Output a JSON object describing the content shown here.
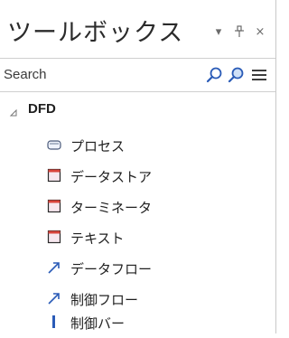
{
  "header": {
    "title": "ツールボックス"
  },
  "window_controls": {
    "dropdown_glyph": "▾",
    "pin_glyph": "ᵽ",
    "close_glyph": "×"
  },
  "search": {
    "placeholder": "Search"
  },
  "group": {
    "label": "DFD",
    "expanded": true
  },
  "items": [
    {
      "label": "プロセス",
      "icon": "process-shape-icon"
    },
    {
      "label": "データストア",
      "icon": "datastore-element-icon"
    },
    {
      "label": "ターミネータ",
      "icon": "terminator-element-icon"
    },
    {
      "label": "テキスト",
      "icon": "text-element-icon"
    },
    {
      "label": "データフロー",
      "icon": "dataflow-arrow-icon"
    },
    {
      "label": "制御フロー",
      "icon": "controlflow-arrow-icon"
    },
    {
      "label": "制御バー",
      "icon": "control-bar-icon"
    }
  ],
  "colors": {
    "accent_blue": "#2a5bb7",
    "element_red": "#d9443c",
    "element_fill": "#f7e7ef"
  }
}
